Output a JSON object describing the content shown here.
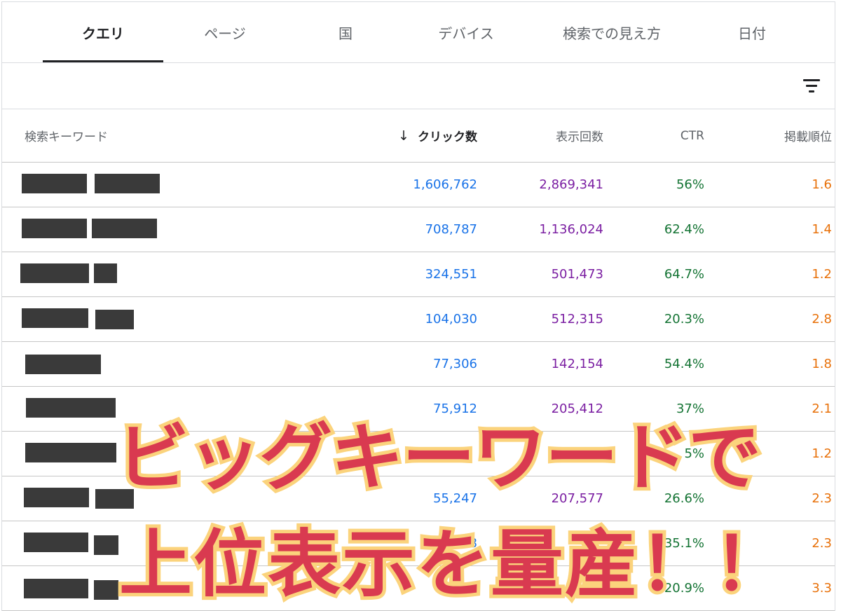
{
  "tabs": [
    {
      "label": "クエリ",
      "active": true
    },
    {
      "label": "ページ"
    },
    {
      "label": "国"
    },
    {
      "label": "デバイス"
    },
    {
      "label": "検索での見え方"
    },
    {
      "label": "日付"
    }
  ],
  "toolbar": {
    "filter_icon": "filter-icon"
  },
  "table": {
    "columns": {
      "query": "検索キーワード",
      "clicks": "クリック数",
      "impressions": "表示回数",
      "ctr": "CTR",
      "position": "掲載順位"
    },
    "sort_icon": "arrow-down-icon",
    "rows": [
      {
        "clicks": "1,606,762",
        "impressions": "2,869,341",
        "ctr": "56%",
        "position": "1.6"
      },
      {
        "clicks": "708,787",
        "impressions": "1,136,024",
        "ctr": "62.4%",
        "position": "1.4"
      },
      {
        "clicks": "324,551",
        "impressions": "501,473",
        "ctr": "64.7%",
        "position": "1.2"
      },
      {
        "clicks": "104,030",
        "impressions": "512,315",
        "ctr": "20.3%",
        "position": "2.8"
      },
      {
        "clicks": "77,306",
        "impressions": "142,154",
        "ctr": "54.4%",
        "position": "1.8"
      },
      {
        "clicks": "75,912",
        "impressions": "205,412",
        "ctr": "37%",
        "position": "2.1"
      },
      {
        "clicks": "",
        "impressions": "",
        "ctr": "5%",
        "position": "1.2"
      },
      {
        "clicks": "55,247",
        "impressions": "207,577",
        "ctr": "26.6%",
        "position": "2.3"
      },
      {
        "clicks": "8",
        "impressions": "",
        "ctr": "35.1%",
        "position": "2.3"
      },
      {
        "clicks": "",
        "impressions": "",
        "ctr": "20.9%",
        "position": "3.3"
      }
    ]
  },
  "overlay": {
    "line1": "ビッグキーワードで",
    "line2": "上位表示を量産！！",
    "fill_color": "#d93a50",
    "outline_color": "#fbd37c"
  }
}
